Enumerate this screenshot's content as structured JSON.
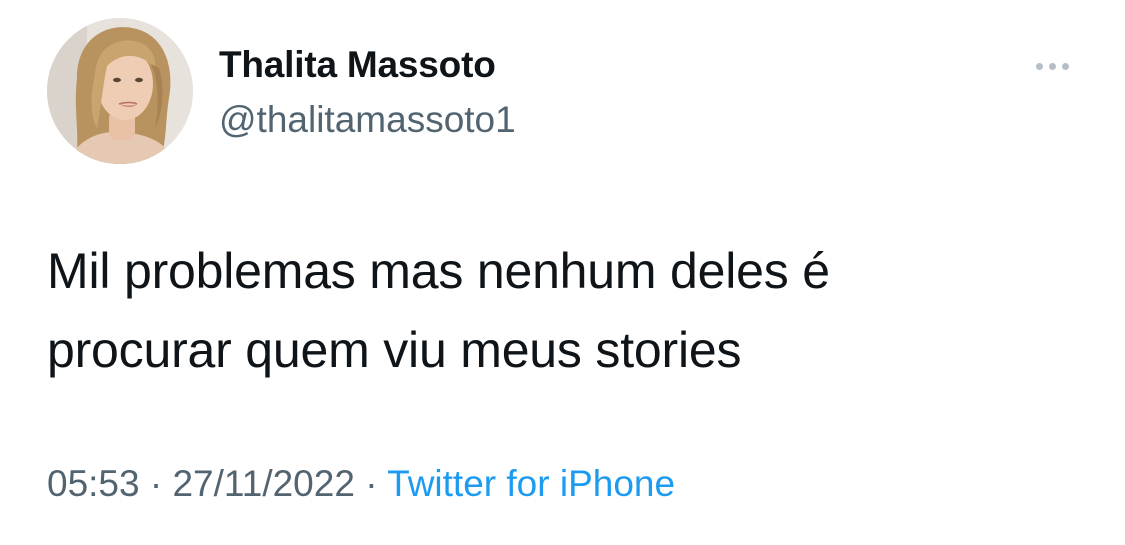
{
  "tweet": {
    "author": {
      "display_name": "Thalita Massoto",
      "handle": "@thalitamassoto1",
      "avatar_icon": "profile-photo"
    },
    "more_icon": "ellipsis-icon",
    "text_lines": [
      "Mil problemas mas nenhum deles é",
      "procurar quem viu meus stories"
    ],
    "time": "05:53",
    "separator": "·",
    "date": "27/11/2022",
    "source": "Twitter for iPhone"
  },
  "colors": {
    "text_primary": "#0f1419",
    "text_secondary": "#536471",
    "link": "#1d9bf0",
    "more_dots": "#b5bec6"
  }
}
